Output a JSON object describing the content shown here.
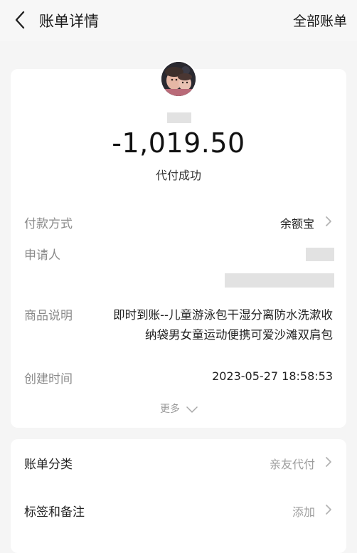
{
  "header": {
    "title": "账单详情",
    "right_link": "全部账单"
  },
  "bill": {
    "amount": "-1,019.50",
    "status": "代付成功",
    "payment_method_label": "付款方式",
    "payment_method_value": "余额宝",
    "applicant_label": "申请人",
    "item_label": "商品说明",
    "item_line1": "即时到账--儿童游泳包干湿分离防水洗漱收",
    "item_line2": "纳袋男女童运动便携可爱沙滩双肩包",
    "created_label": "创建时间",
    "created_value": "2023-05-27 18:58:53",
    "more": "更多"
  },
  "details": {
    "category_label": "账单分类",
    "category_value": "亲友代付",
    "tags_label": "标签和备注",
    "tags_value": "添加"
  },
  "icons": {
    "back": "chevron-left-icon",
    "avatar": "avatar",
    "chevron_right": "chevron-right-icon",
    "chevron_down": "chevron-down-icon"
  }
}
